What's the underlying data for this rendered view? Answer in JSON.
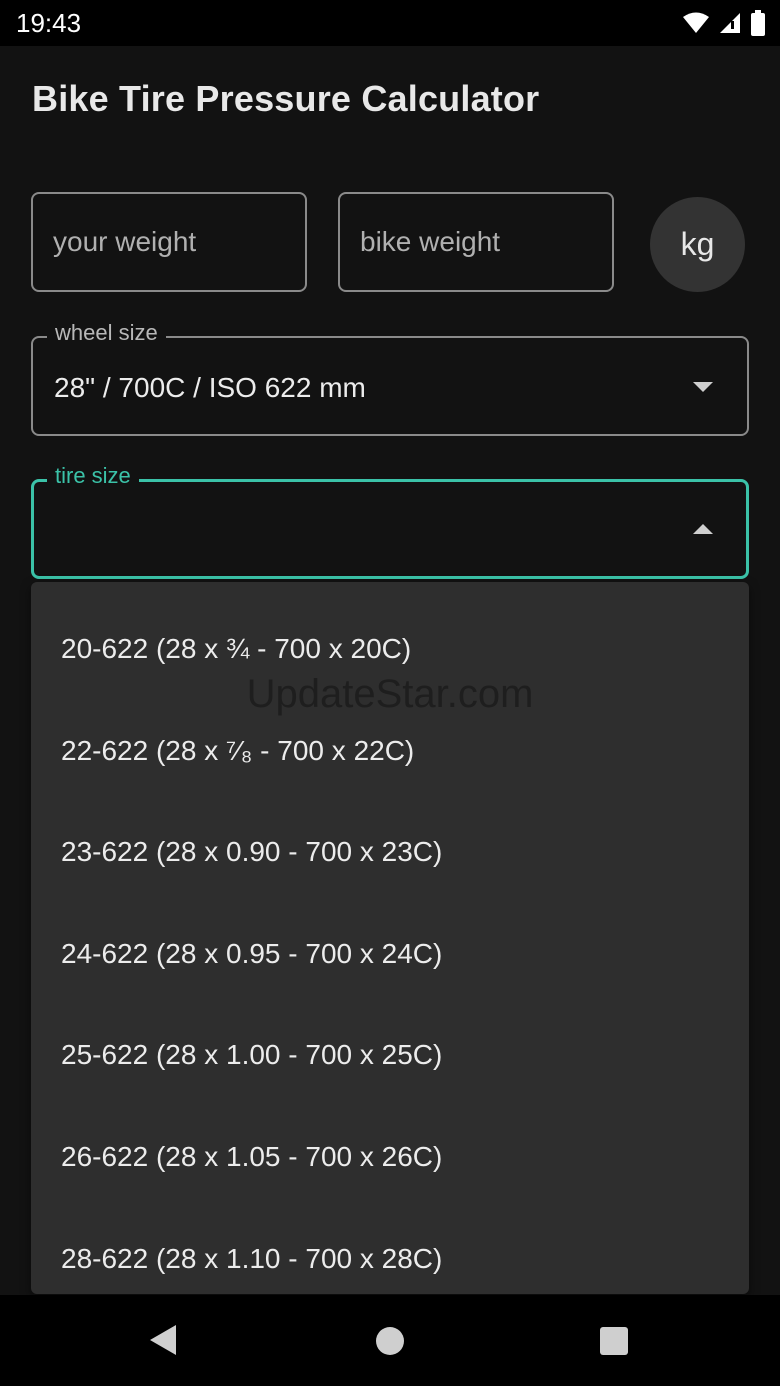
{
  "status_bar": {
    "time": "19:43"
  },
  "app": {
    "title": "Bike Tire Pressure Calculator"
  },
  "inputs": {
    "your_weight": {
      "value": "",
      "placeholder": "your weight"
    },
    "bike_weight": {
      "value": "",
      "placeholder": "bike weight"
    },
    "unit_label": "kg"
  },
  "wheel_size": {
    "label": "wheel size",
    "value": "28\" / 700C / ISO 622 mm"
  },
  "tire_size": {
    "label": "tire size",
    "value": ""
  },
  "dropdown": {
    "items": [
      "20-622 (28 x ¾ - 700 x 20C)",
      "22-622 (28 x ⁷⁄₈ - 700 x 22C)",
      "23-622 (28 x 0.90 - 700 x 23C)",
      "24-622 (28 x 0.95 - 700 x 24C)",
      "25-622 (28 x 1.00 - 700 x 25C)",
      "26-622 (28 x 1.05 - 700 x 26C)",
      "28-622 (28 x 1.10 - 700 x 28C)"
    ]
  },
  "watermark": "UpdateStar.com",
  "colors": {
    "accent": "#3bc2a8",
    "background": "#121212",
    "menu": "#2e2e2e"
  }
}
